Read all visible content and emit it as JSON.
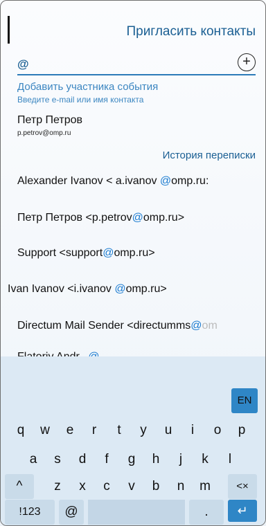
{
  "header": {
    "title": "Пригласить контакты"
  },
  "input": {
    "value": "@",
    "add_icon": "plus-circle-icon"
  },
  "hint": {
    "title": "Добавить участника события",
    "subtitle": "Введите e-mail или имя контакта"
  },
  "suggestion": {
    "name": "Петр Петров",
    "email": "p.petrov@omp.ru"
  },
  "history": {
    "label": "История переписки",
    "items": [
      {
        "before": "Alexander  Ivanov  <  a.ivanov ",
        "at": "@",
        "after": "omp.ru:"
      },
      {
        "before": "Петр Петров <p.petrov",
        "at": "@",
        "after": "omp.ru>"
      },
      {
        "before": "Support <support",
        "at": "@",
        "after": "omp.ru>"
      },
      {
        "before": "Ivan Ivanov  <i.ivanov ",
        "at": "@",
        "after": "omp.ru>"
      },
      {
        "before": "Directum Mail Sender <directumms",
        "at": "@",
        "after": "om"
      },
      {
        "before": "Flatoriy Andr...",
        "at": "@",
        "after": ""
      }
    ]
  },
  "keyboard": {
    "lang": "EN",
    "row1": [
      "q",
      "w",
      "e",
      "r",
      "t",
      "y",
      "u",
      "i",
      "o",
      "p"
    ],
    "row2": [
      "a",
      "s",
      "d",
      "f",
      "g",
      "h",
      "j",
      "k",
      "l"
    ],
    "row3": [
      "z",
      "x",
      "c",
      "v",
      "b",
      "n",
      "m"
    ],
    "shift": "^",
    "backspace": "<×",
    "symbols": "!123",
    "at": "@",
    "period": ".",
    "enter": "↵"
  }
}
